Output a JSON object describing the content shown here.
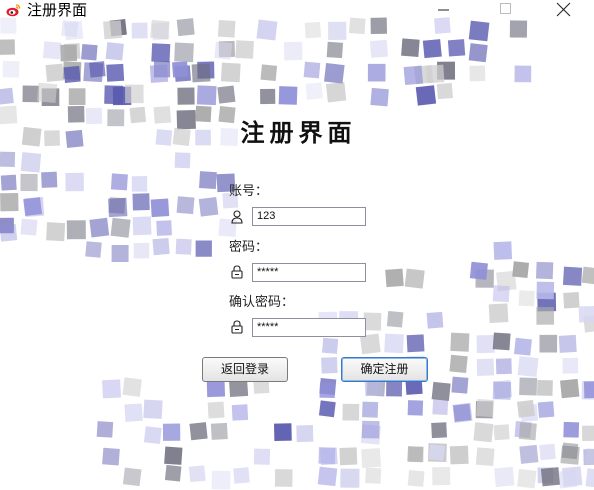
{
  "window": {
    "title": "注册界面",
    "app_icon": "weibo-icon"
  },
  "form": {
    "heading": "注册界面",
    "account_label": "账号：",
    "account_value": "123",
    "account_icon": "user-icon",
    "password_label": "密码：",
    "password_value": "*****",
    "password_icon": "lock-icon",
    "confirm_label": "确认密码：",
    "confirm_value": "*****",
    "confirm_icon": "lock-icon"
  },
  "buttons": {
    "back_label": "返回登录",
    "confirm_label": "确定注册"
  },
  "colors": {
    "mosaic": [
      "#5a5ab0",
      "#8f8fd8",
      "#b7b7ea",
      "#d6d6f2",
      "#a8a8a8",
      "#cfcfcf",
      "#6e6e7e"
    ],
    "confirm_border": "#3b78c4"
  }
}
